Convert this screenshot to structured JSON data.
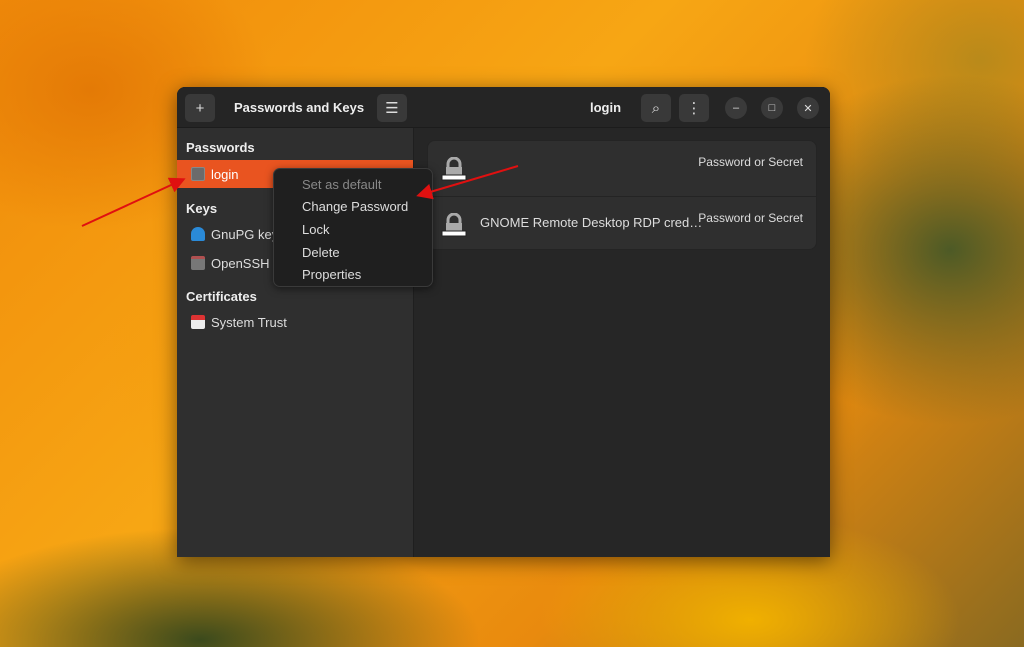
{
  "window": {
    "title": "Passwords and Keys",
    "main_title": "login"
  },
  "sidebar": {
    "sections": [
      {
        "label": "Passwords"
      },
      {
        "label": "Keys"
      },
      {
        "label": "Certificates"
      }
    ],
    "items": [
      {
        "label": "login",
        "selected": true
      },
      {
        "label": "GnuPG keys"
      },
      {
        "label": "OpenSSH keys"
      },
      {
        "label": "System Trust"
      }
    ]
  },
  "list": [
    {
      "name": "",
      "type": "Password or Secret"
    },
    {
      "name": "GNOME Remote Desktop RDP cred…",
      "type": "Password or Secret"
    }
  ],
  "context_menu": [
    {
      "label": "Set as default",
      "disabled": true
    },
    {
      "label": "Change Password"
    },
    {
      "label": "Lock"
    },
    {
      "label": "Delete"
    },
    {
      "label": "Properties"
    }
  ],
  "colors": {
    "accent": "#e95420",
    "arrow": "#e01010"
  }
}
